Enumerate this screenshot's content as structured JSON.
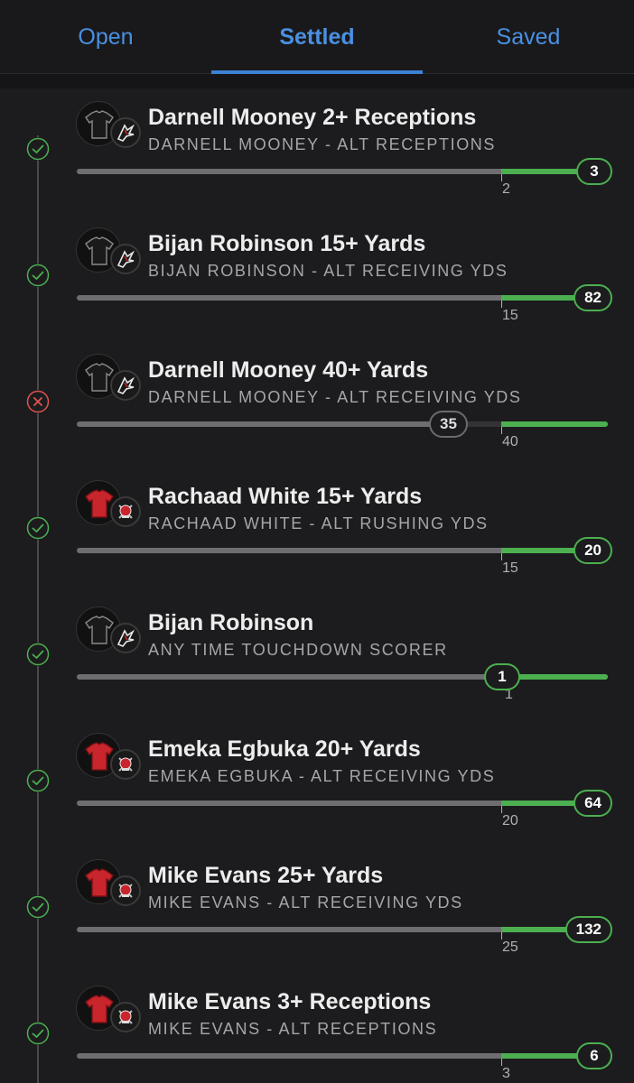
{
  "tabs": [
    {
      "label": "Open",
      "active": false
    },
    {
      "label": "Settled",
      "active": true
    },
    {
      "label": "Saved",
      "active": false
    }
  ],
  "colors": {
    "accent": "#4a90e2",
    "hit": "#4caf50",
    "miss": "#e05252",
    "background": "#1c1c1e"
  },
  "legs": [
    {
      "title": "Darnell Mooney 2+ Receptions",
      "subtitle": "DARNELL MOONEY - ALT RECEPTIONS",
      "threshold": "2",
      "result": "3",
      "status": "hit",
      "team": "falcons",
      "progress": 1.0
    },
    {
      "title": "Bijan Robinson 15+ Yards",
      "subtitle": "BIJAN ROBINSON - ALT RECEIVING YDS",
      "threshold": "15",
      "result": "82",
      "status": "hit",
      "team": "falcons",
      "progress": 1.0
    },
    {
      "title": "Darnell Mooney 40+ Yards",
      "subtitle": "DARNELL MOONEY - ALT RECEIVING YDS",
      "threshold": "40",
      "result": "35",
      "status": "miss",
      "team": "falcons",
      "progress": 0.875
    },
    {
      "title": "Rachaad White 15+ Yards",
      "subtitle": "RACHAAD WHITE - ALT RUSHING YDS",
      "threshold": "15",
      "result": "20",
      "status": "hit",
      "team": "buccaneers",
      "progress": 1.0
    },
    {
      "title": "Bijan Robinson",
      "subtitle": "ANY TIME TOUCHDOWN SCORER",
      "threshold": "1",
      "result": "1",
      "status": "hit",
      "team": "falcons",
      "progress": 1.0
    },
    {
      "title": "Emeka Egbuka 20+ Yards",
      "subtitle": "EMEKA EGBUKA - ALT RECEIVING YDS",
      "threshold": "20",
      "result": "64",
      "status": "hit",
      "team": "buccaneers",
      "progress": 1.0
    },
    {
      "title": "Mike Evans 25+ Yards",
      "subtitle": "MIKE EVANS - ALT RECEIVING YDS",
      "threshold": "25",
      "result": "132",
      "status": "hit",
      "team": "buccaneers",
      "progress": 1.0
    },
    {
      "title": "Mike Evans 3+ Receptions",
      "subtitle": "MIKE EVANS - ALT RECEPTIONS",
      "threshold": "3",
      "result": "6",
      "status": "hit",
      "team": "buccaneers",
      "progress": 1.0
    }
  ]
}
